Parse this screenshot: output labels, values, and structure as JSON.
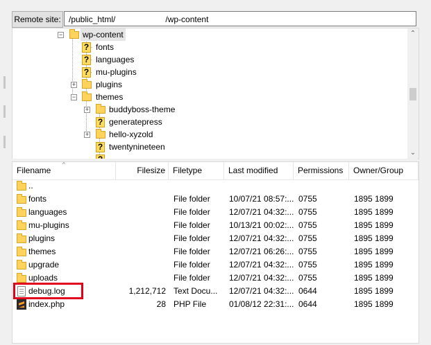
{
  "remote_site": {
    "label": "Remote site:",
    "path_prefix": "/public_html/",
    "path_suffix": "/wp-content"
  },
  "tree": {
    "items": [
      {
        "label": "wp-content",
        "icon": "folder-open",
        "selected": true
      },
      {
        "label": "fonts",
        "icon": "question-folder"
      },
      {
        "label": "languages",
        "icon": "question-folder"
      },
      {
        "label": "mu-plugins",
        "icon": "question-folder"
      },
      {
        "label": "plugins",
        "icon": "folder",
        "expander": "+"
      },
      {
        "label": "themes",
        "icon": "folder",
        "expander": "-"
      },
      {
        "label": "buddyboss-theme",
        "icon": "folder",
        "expander": "+"
      },
      {
        "label": "generatepress",
        "icon": "question-folder"
      },
      {
        "label": "hello-xyzold",
        "icon": "folder",
        "expander": "+"
      },
      {
        "label": "twentynineteen",
        "icon": "question-folder"
      },
      {
        "label": "",
        "icon": "question-folder"
      }
    ]
  },
  "list": {
    "columns": {
      "filename": "Filename",
      "filesize": "Filesize",
      "filetype": "Filetype",
      "last_modified": "Last modified",
      "permissions": "Permissions",
      "owner_group": "Owner/Group"
    },
    "rows": [
      {
        "name": "..",
        "size": "",
        "type": "",
        "modified": "",
        "perms": "",
        "owner": "",
        "icon": "folder"
      },
      {
        "name": "fonts",
        "size": "",
        "type": "File folder",
        "modified": "10/07/21 08:57:...",
        "perms": "0755",
        "owner": "1895 1899",
        "icon": "folder"
      },
      {
        "name": "languages",
        "size": "",
        "type": "File folder",
        "modified": "12/07/21 04:32:...",
        "perms": "0755",
        "owner": "1895 1899",
        "icon": "folder"
      },
      {
        "name": "mu-plugins",
        "size": "",
        "type": "File folder",
        "modified": "10/13/21 00:02:...",
        "perms": "0755",
        "owner": "1895 1899",
        "icon": "folder"
      },
      {
        "name": "plugins",
        "size": "",
        "type": "File folder",
        "modified": "12/07/21 04:32:...",
        "perms": "0755",
        "owner": "1895 1899",
        "icon": "folder"
      },
      {
        "name": "themes",
        "size": "",
        "type": "File folder",
        "modified": "12/07/21 06:26:...",
        "perms": "0755",
        "owner": "1895 1899",
        "icon": "folder"
      },
      {
        "name": "upgrade",
        "size": "",
        "type": "File folder",
        "modified": "12/07/21 04:32:...",
        "perms": "0755",
        "owner": "1895 1899",
        "icon": "folder"
      },
      {
        "name": "uploads",
        "size": "",
        "type": "File folder",
        "modified": "12/07/21 04:32:...",
        "perms": "0755",
        "owner": "1895 1899",
        "icon": "folder"
      },
      {
        "name": "debug.log",
        "size": "1,212,712",
        "type": "Text Docu...",
        "modified": "12/07/21 04:32:...",
        "perms": "0644",
        "owner": "1895 1899",
        "icon": "text-file",
        "highlighted": true
      },
      {
        "name": "index.php",
        "size": "28",
        "type": "PHP File",
        "modified": "01/08/12 22:31:...",
        "perms": "0644",
        "owner": "1895 1899",
        "icon": "php-file"
      }
    ]
  },
  "colors": {
    "highlight_border": "#e0001b",
    "folder": "#ffd35c"
  }
}
